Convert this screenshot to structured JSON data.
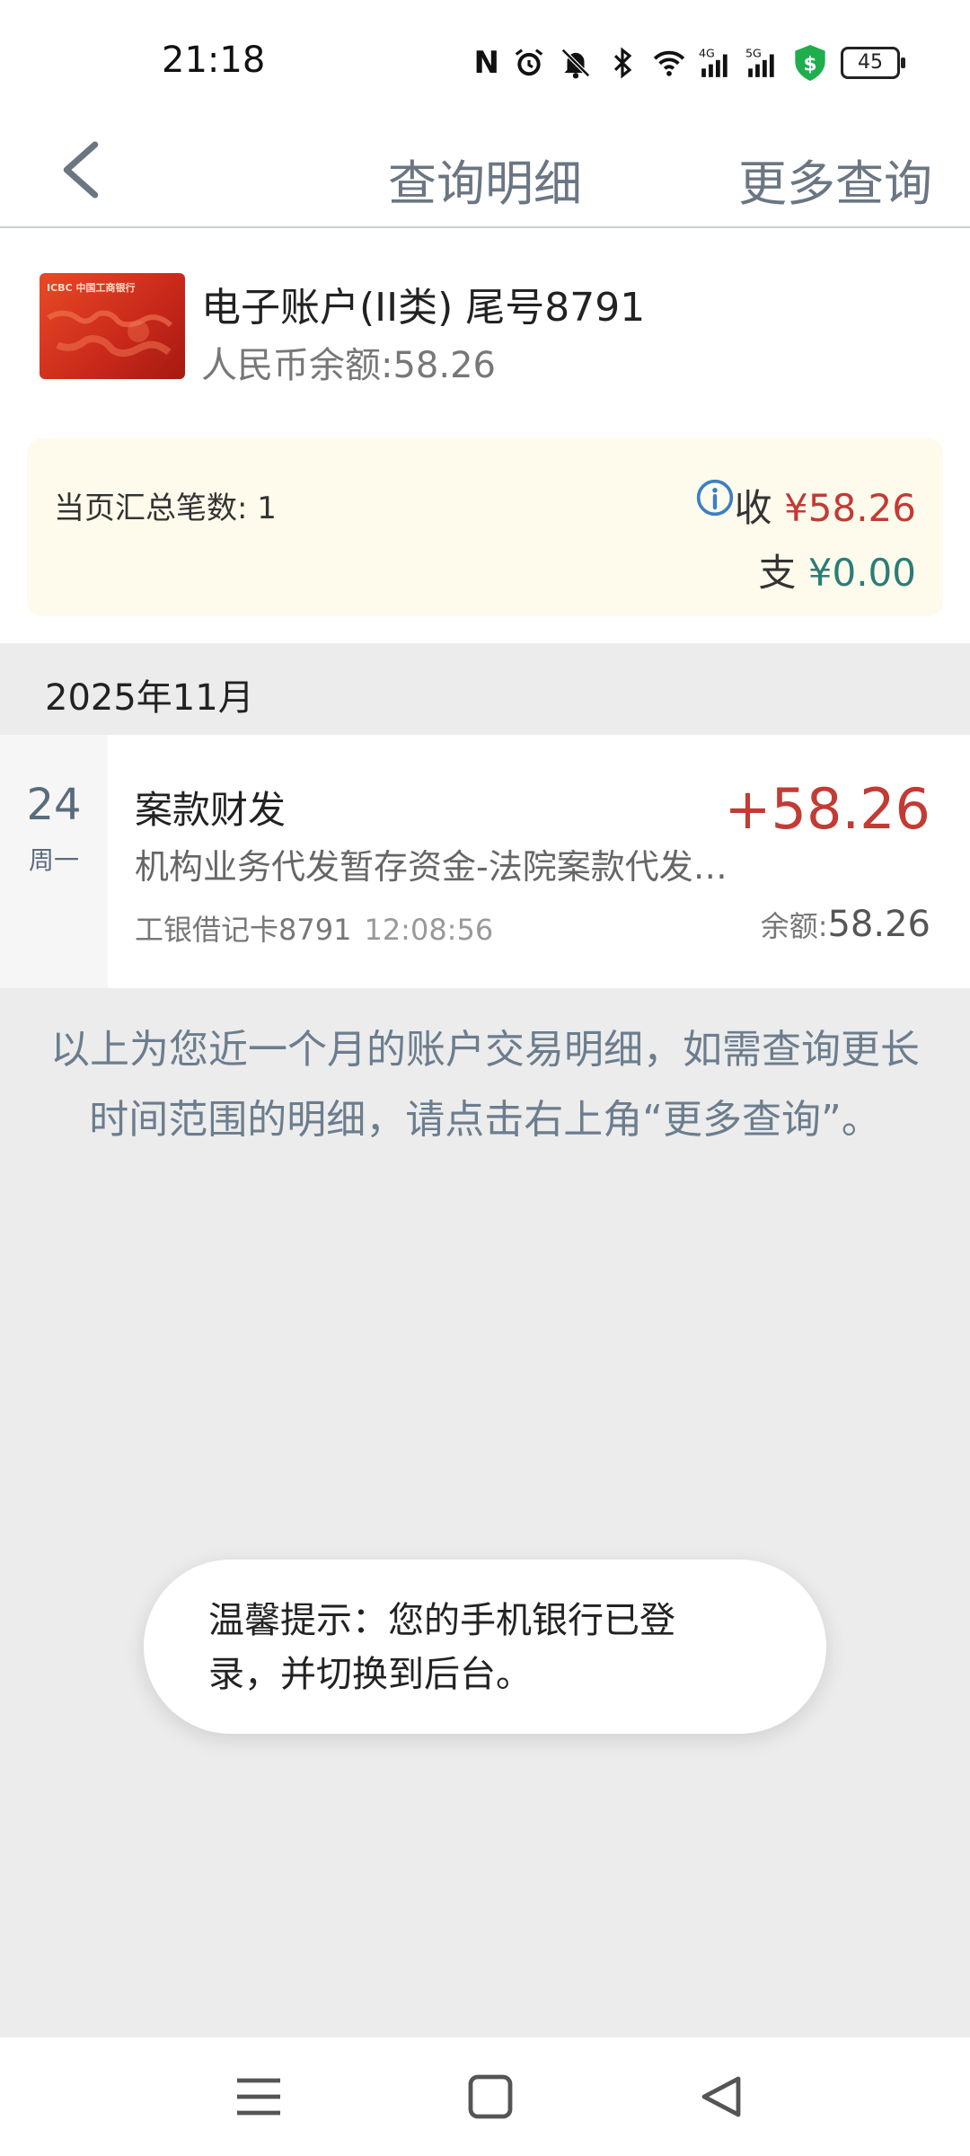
{
  "status_bar": {
    "time": "21:18",
    "battery": "45",
    "icons": [
      "nfc-icon",
      "alarm-icon",
      "bell-off-icon",
      "bluetooth-icon",
      "wifi-icon",
      "signal-4g-icon",
      "signal-5g-icon",
      "security-shield-icon",
      "battery-icon"
    ]
  },
  "header": {
    "title": "查询明细",
    "more_label": "更多查询",
    "back_icon": "chevron-left-icon"
  },
  "account": {
    "name": "电子账户(II类)  尾号8791",
    "balance": "人民币余额:58.26",
    "card_logo": "ICBC 中国工商银行"
  },
  "summary": {
    "count_label": "当页汇总笔数: 1",
    "income_label": "收",
    "income_value": "¥58.26",
    "expense_label": "支",
    "expense_value": "¥0.00",
    "info_icon": "info-icon"
  },
  "month_header": "2025年11月",
  "transactions": [
    {
      "day": "24",
      "weekday": "周一",
      "title": "案款财发",
      "description": "机构业务代发暂存资金-法院案款代发…",
      "card": "工银借记卡8791",
      "time": "12:08:56",
      "amount": "+58.26",
      "balance_label": "余额:",
      "balance_value": "58.26"
    }
  ],
  "notice": "以上为您近一个月的账户交易明细，如需查询更长时间范围的明细，请点击右上角“更多查询”。",
  "toast": "温馨提示：您的手机银行已登录，并切换到后台。",
  "colors": {
    "income": "#c23b34",
    "expense": "#2a7d77",
    "header_text": "#6b7683",
    "summary_bg": "#fffbec",
    "page_bg": "#ececec"
  }
}
